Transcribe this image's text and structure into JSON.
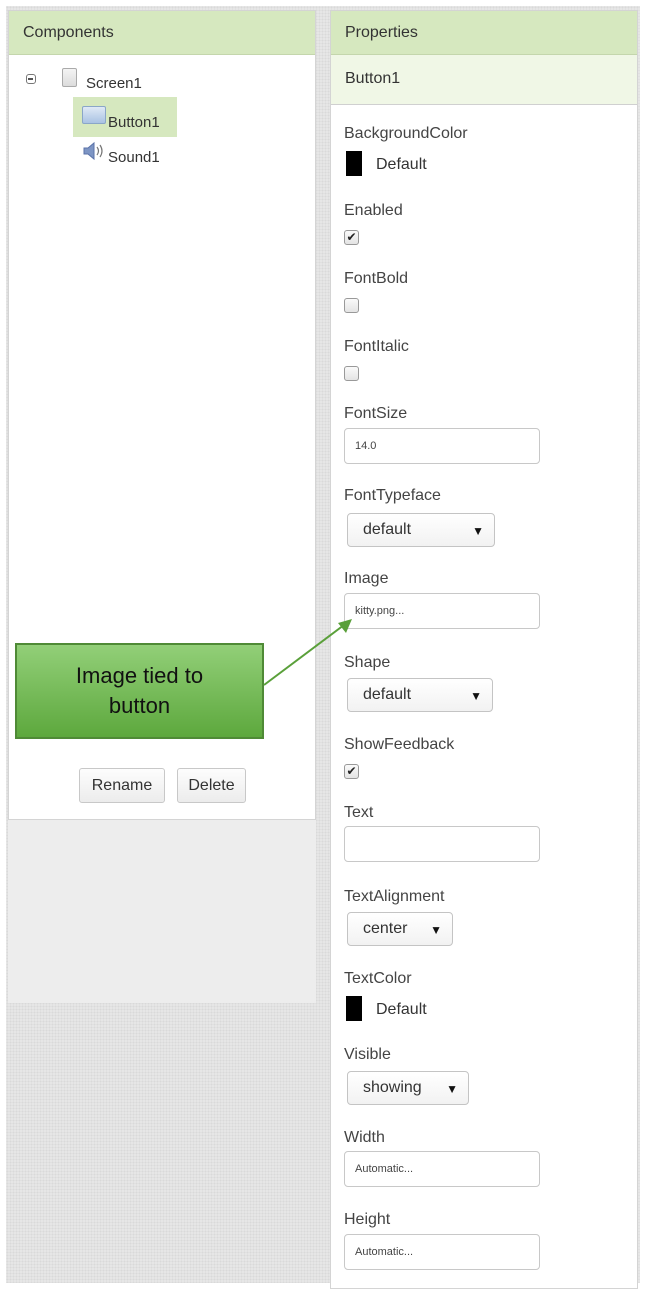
{
  "components": {
    "title": "Components",
    "tree": [
      {
        "label": "Screen1"
      },
      {
        "label": "Button1"
      },
      {
        "label": "Sound1"
      }
    ],
    "rename_label": "Rename",
    "delete_label": "Delete"
  },
  "callout": {
    "text": "Image tied to button"
  },
  "properties": {
    "title": "Properties",
    "component": "Button1",
    "background_color": {
      "label": "BackgroundColor",
      "value": "Default"
    },
    "enabled": {
      "label": "Enabled",
      "checked": true
    },
    "font_bold": {
      "label": "FontBold",
      "checked": false
    },
    "font_italic": {
      "label": "FontItalic",
      "checked": false
    },
    "font_size": {
      "label": "FontSize",
      "value": "14.0"
    },
    "font_typeface": {
      "label": "FontTypeface",
      "value": "default"
    },
    "image": {
      "label": "Image",
      "value": "kitty.png..."
    },
    "shape": {
      "label": "Shape",
      "value": "default"
    },
    "show_feedback": {
      "label": "ShowFeedback",
      "checked": true
    },
    "text": {
      "label": "Text",
      "value": ""
    },
    "text_alignment": {
      "label": "TextAlignment",
      "value": "center"
    },
    "text_color": {
      "label": "TextColor",
      "value": "Default"
    },
    "visible": {
      "label": "Visible",
      "value": "showing"
    },
    "width": {
      "label": "Width",
      "value": "Automatic..."
    },
    "height": {
      "label": "Height",
      "value": "Automatic..."
    }
  },
  "colors": {
    "header_green": "#d6e8bf",
    "callout_green": "#70b94f",
    "arrow_green": "#5aa03a"
  }
}
